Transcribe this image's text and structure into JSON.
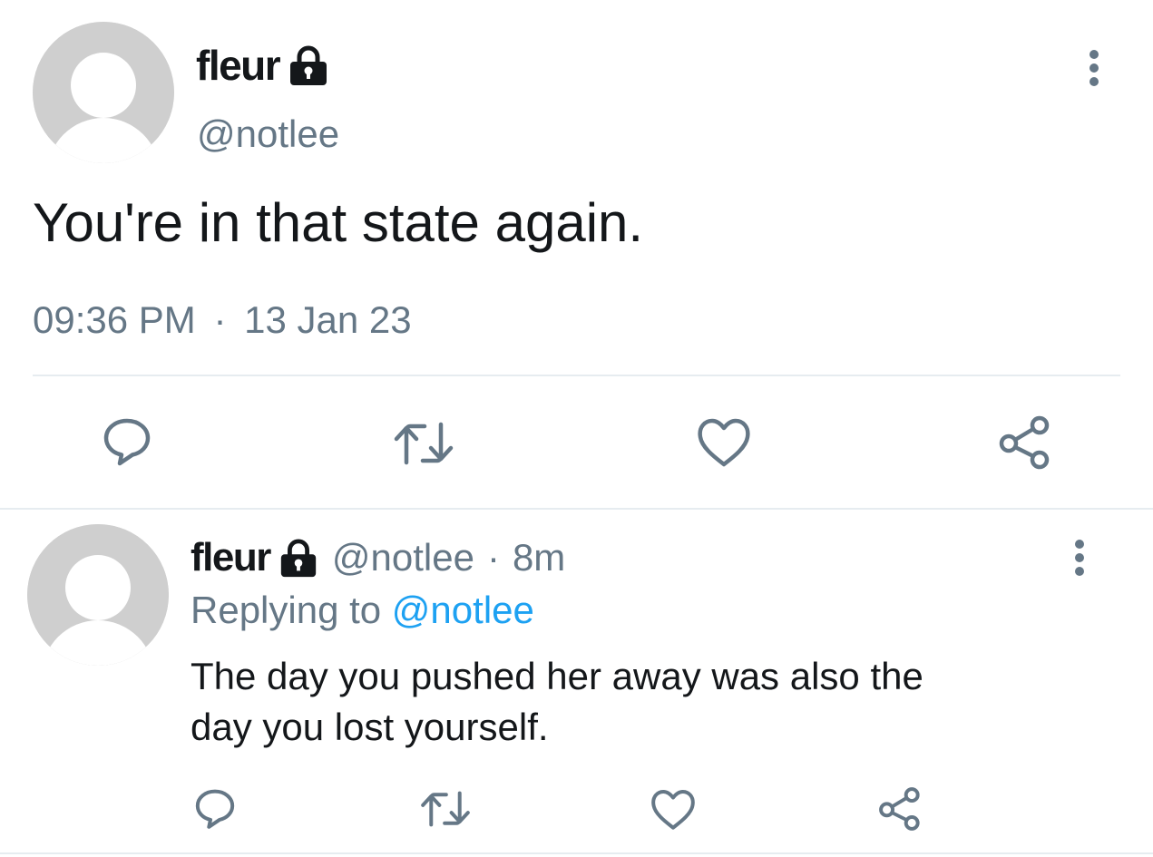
{
  "main_tweet": {
    "display_name": "fleur",
    "handle": "@notlee",
    "text": "You're in that state again.",
    "time": "09:36 PM",
    "separator": "·",
    "date": "13 Jan 23"
  },
  "reply": {
    "display_name": "fleur",
    "handle": "@notlee",
    "dot": "·",
    "age": "8m",
    "replying_prefix": "Replying to",
    "replying_handle": "@notlee",
    "text_line1": "The day you pushed her away was also the",
    "text_line2": "day you lost yourself."
  },
  "colors": {
    "text": "#14171a",
    "muted": "#657786",
    "link": "#1da1f2",
    "icon": "#657786",
    "divider": "#e6ecf0",
    "avatar_bg": "#cfcfcf"
  },
  "icons": [
    "avatar-placeholder-icon",
    "lock-icon",
    "more-vert-icon",
    "reply-icon",
    "retweet-icon",
    "like-icon",
    "share-icon"
  ]
}
